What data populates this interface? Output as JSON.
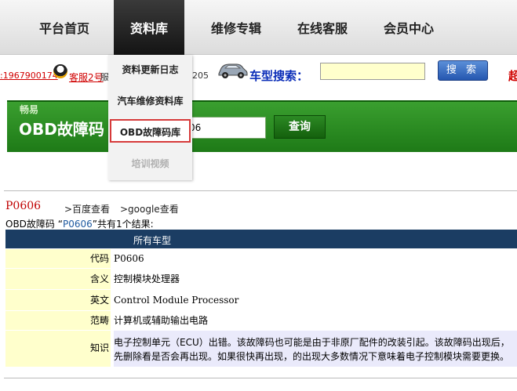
{
  "nav": {
    "items": [
      {
        "label": "平台首页"
      },
      {
        "label": "资料库"
      },
      {
        "label": "维修专辑"
      },
      {
        "label": "在线客服"
      },
      {
        "label": "会员中心"
      }
    ]
  },
  "topbar": {
    "qq_number": ":1967900174",
    "qq_label": "客服2号",
    "hidden_tail": "服",
    "num_fragment": "205",
    "search_label": "车型搜索：",
    "search_value": "",
    "search_button": "搜 索",
    "right_glyph": "超"
  },
  "dropdown": {
    "items": [
      {
        "label": "资料更新日志"
      },
      {
        "label": "汽车维修资料库"
      },
      {
        "label": "OBD故障码库"
      },
      {
        "label": "培训视频"
      }
    ]
  },
  "banner": {
    "sub": "畅易",
    "title": "OBD故障码",
    "input_value": "06",
    "button": "查询"
  },
  "result": {
    "code": "P0606",
    "link_baidu": ">百度查看",
    "link_google": ">google查看",
    "count_prefix": "OBD故障码 “",
    "count_code": "P0606",
    "count_suffix": "”共有1个结果:",
    "header": "所有车型",
    "rows": [
      {
        "label": "代码",
        "value": "P0606"
      },
      {
        "label": "含义",
        "value": "控制模块处理器"
      },
      {
        "label": "英文",
        "value": "Control Module Processor"
      },
      {
        "label": "范畴",
        "value": "计算机或辅助输出电路"
      },
      {
        "label": "知识",
        "value": "电子控制单元（ECU）出错。该故障码也可能是由于非原厂配件的改装引起。该故障码出现后，先删除看是否会再出现。如果很快再出现，的出现大多数情况下意味着电子控制模块需要更换。"
      }
    ]
  }
}
